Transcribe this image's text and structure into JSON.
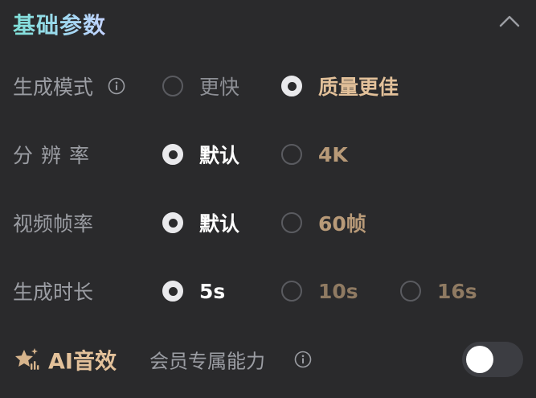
{
  "section": {
    "title": "基础参数",
    "collapse_icon": "chevron-up-icon"
  },
  "rows": {
    "mode": {
      "label": "生成模式",
      "info_icon": "info-icon",
      "options": [
        {
          "label": "更快",
          "selected": false
        },
        {
          "label": "质量更佳",
          "selected": true
        }
      ]
    },
    "resolution": {
      "label": "分辨率",
      "options": [
        {
          "label": "默认",
          "selected": true
        },
        {
          "label": "4K",
          "selected": false
        }
      ]
    },
    "framerate": {
      "label": "视频帧率",
      "options": [
        {
          "label": "默认",
          "selected": true
        },
        {
          "label": "60帧",
          "selected": false
        }
      ]
    },
    "duration": {
      "label": "生成时长",
      "options": [
        {
          "label": "5s",
          "selected": true
        },
        {
          "label": "10s",
          "selected": false
        },
        {
          "label": "16s",
          "selected": false
        }
      ]
    }
  },
  "ai_sound": {
    "title": "AI音效",
    "subtitle": "会员专属能力",
    "icon": "sparkle-star-icon",
    "info_icon": "info-icon",
    "toggle_on": false
  },
  "colors": {
    "background": "#2a2a2c",
    "gold_accent": "#d7b48c",
    "title_gradient_start": "#7fe0d8",
    "title_gradient_end": "#c3d2ff"
  }
}
